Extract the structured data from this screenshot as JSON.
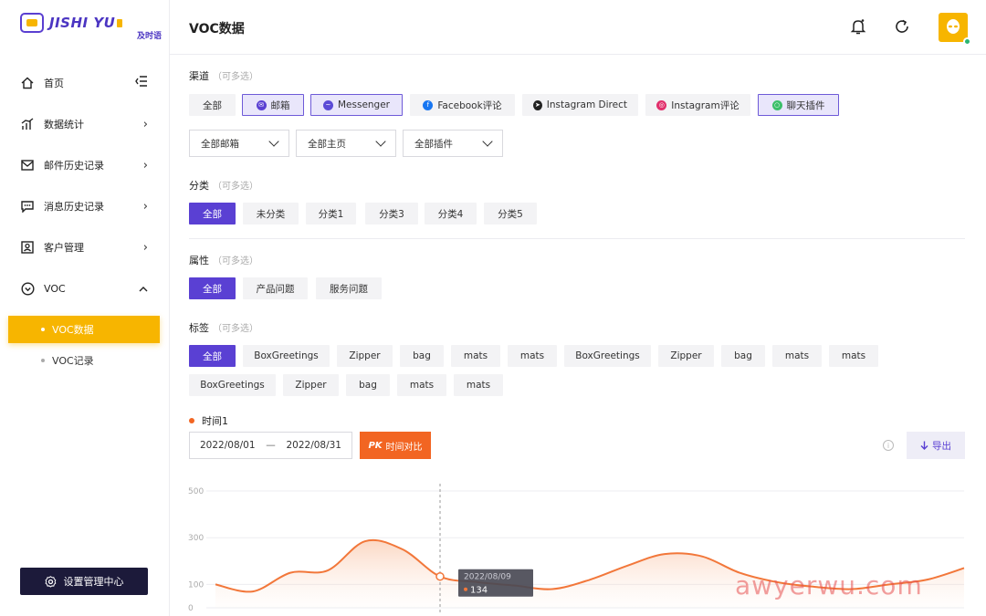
{
  "app": {
    "logo_text": "JISHI YU",
    "logo_sub": "及时语"
  },
  "sidebar": {
    "items": [
      {
        "label": "首页"
      },
      {
        "label": "数据统计"
      },
      {
        "label": "邮件历史记录"
      },
      {
        "label": "消息历史记录"
      },
      {
        "label": "客户管理"
      },
      {
        "label": "VOC"
      }
    ],
    "voc_children": [
      {
        "label": "VOC数据"
      },
      {
        "label": "VOC记录"
      }
    ],
    "settings_label": "设置管理中心"
  },
  "header": {
    "title": "VOC数据"
  },
  "filters": {
    "channel": {
      "label": "渠道",
      "hint": "（可多选）",
      "chips": [
        "全部",
        "邮箱",
        "Messenger",
        "Facebook评论",
        "Instagram Direct",
        "Instagram评论",
        "聊天插件"
      ],
      "selects": [
        "全部邮箱",
        "全部主页",
        "全部插件"
      ]
    },
    "category": {
      "label": "分类",
      "hint": "（可多选）",
      "chips": [
        "全部",
        "未分类",
        "分类1",
        "分类3",
        "分类4",
        "分类5"
      ]
    },
    "attribute": {
      "label": "属性",
      "hint": "（可多选）",
      "chips": [
        "全部",
        "产品问题",
        "服务问题"
      ]
    },
    "tags": {
      "label": "标签",
      "hint": "（可多选）",
      "row1": [
        "全部",
        "BoxGreetings",
        "Zipper",
        "bag",
        "mats",
        "mats",
        "BoxGreetings",
        "Zipper",
        "bag",
        "mats",
        "mats"
      ],
      "row2": [
        "BoxGreetings",
        "Zipper",
        "bag",
        "mats",
        "mats"
      ]
    }
  },
  "time": {
    "label": "时间1",
    "start": "2022/08/01",
    "sep": "—",
    "end": "2022/08/31",
    "pk_prefix": "PK",
    "pk_label": "时间对比",
    "export_label": "导出",
    "info_glyph": "i"
  },
  "chart_data": {
    "type": "area",
    "y_ticks": [
      "500",
      "300",
      "100",
      "0"
    ],
    "ylim": [
      0,
      500
    ],
    "x": [
      0,
      1,
      2,
      3,
      4,
      5,
      6,
      7,
      8,
      9,
      10,
      11,
      12,
      13,
      14,
      15,
      16,
      17,
      18,
      19,
      20
    ],
    "values": [
      100,
      70,
      150,
      160,
      285,
      250,
      134,
      110,
      95,
      80,
      120,
      180,
      230,
      220,
      150,
      110,
      90,
      80,
      100,
      120,
      170
    ],
    "tooltip": {
      "date": "2022/08/09",
      "value": "134"
    },
    "color": "#f2773a"
  },
  "watermark": "awyerwu.com"
}
